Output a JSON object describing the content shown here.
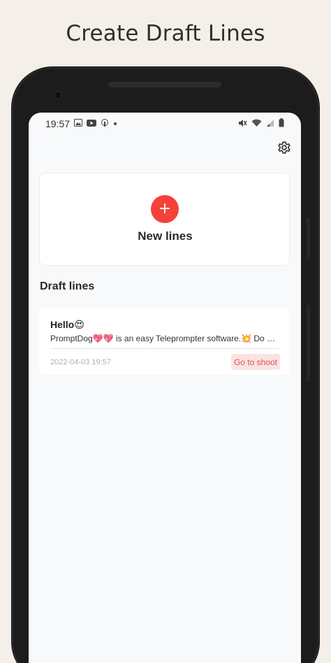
{
  "headline": "Create Draft Lines",
  "status_bar": {
    "time": "19:57",
    "left_icons": [
      "image-icon",
      "youtube-icon",
      "podcast-icon",
      "dot-icon"
    ],
    "right_icons": [
      "mute-icon",
      "wifi-icon",
      "signal-icon",
      "battery-icon"
    ]
  },
  "toolbar": {
    "settings_icon": "gear-icon"
  },
  "new_card": {
    "plus": "+",
    "label": "New lines"
  },
  "drafts": {
    "section_title": "Draft lines",
    "items": [
      {
        "title": "Hello😍",
        "preview": "PromptDog💖💖 is an easy Teleprompter software.💥 Do you ...",
        "date": "2022-04-03 19:57",
        "action_label": "Go to shoot"
      }
    ]
  },
  "colors": {
    "accent": "#f5413a",
    "background": "#f5efe9",
    "screen": "#f8f9fb",
    "action_bg": "#fbe3e3",
    "action_text": "#e0504c"
  }
}
